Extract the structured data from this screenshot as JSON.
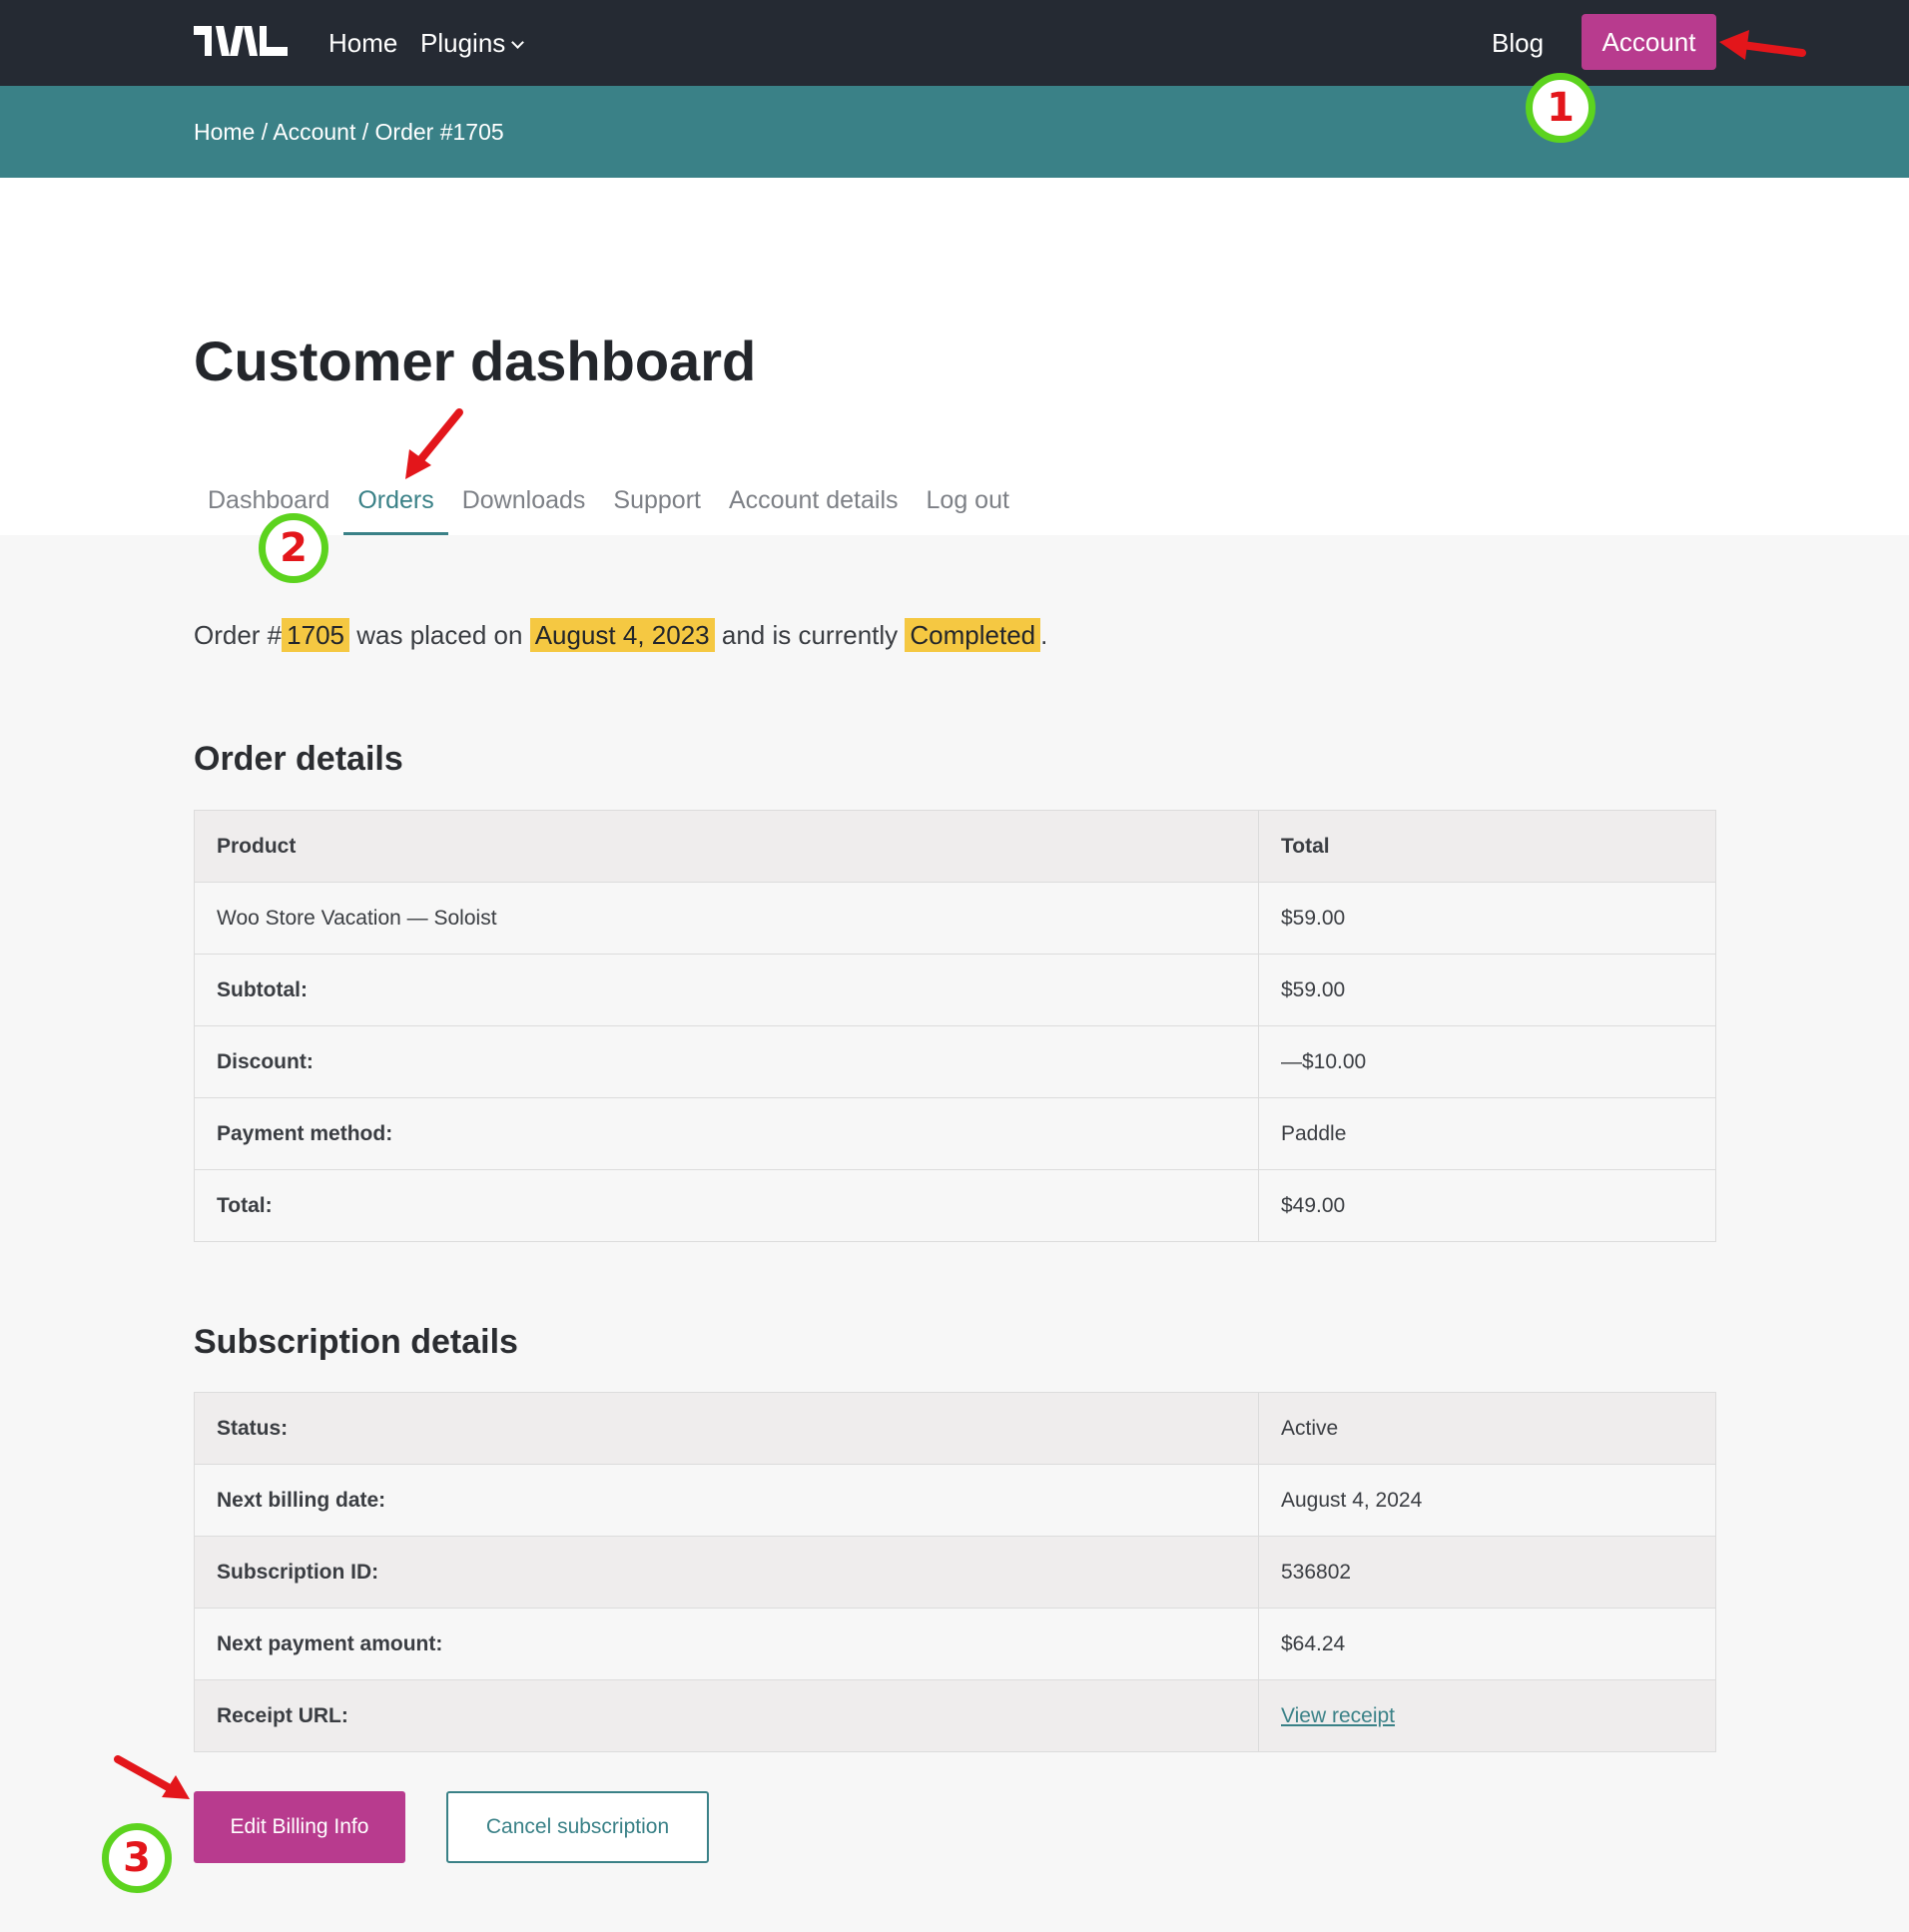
{
  "header": {
    "nav": {
      "home": "Home",
      "plugins": "Plugins",
      "blog": "Blog",
      "account": "Account"
    }
  },
  "breadcrumb": {
    "text": "Home / Account / Order #1705"
  },
  "page": {
    "title": "Customer dashboard"
  },
  "tabs": [
    {
      "label": "Dashboard",
      "active": false
    },
    {
      "label": "Orders",
      "active": true
    },
    {
      "label": "Downloads",
      "active": false
    },
    {
      "label": "Support",
      "active": false
    },
    {
      "label": "Account details",
      "active": false
    },
    {
      "label": "Log out",
      "active": false
    }
  ],
  "summary": {
    "prefix": "Order #",
    "order_number": "1705",
    "mid1": "was placed on",
    "date": "August 4, 2023",
    "mid2": "and is currently",
    "status": "Completed",
    "suffix": "."
  },
  "order_details": {
    "title": "Order details",
    "header": {
      "product": "Product",
      "total": "Total"
    },
    "item": {
      "product": "Woo Store Vacation — Soloist",
      "total": "$59.00"
    },
    "subtotal": {
      "label": "Subtotal:",
      "value": "$59.00"
    },
    "discount": {
      "label": "Discount:",
      "value": "—$10.00"
    },
    "payment_method": {
      "label": "Payment method:",
      "value": "Paddle"
    },
    "total": {
      "label": "Total:",
      "value": "$49.00"
    }
  },
  "subscription_details": {
    "title": "Subscription details",
    "status": {
      "label": "Status:",
      "value": "Active"
    },
    "next_billing_date": {
      "label": "Next billing date:",
      "value": "August 4, 2024"
    },
    "subscription_id": {
      "label": "Subscription ID:",
      "value": "536802"
    },
    "next_payment_amount": {
      "label": "Next payment amount:",
      "value": "$64.24"
    },
    "receipt_url": {
      "label": "Receipt URL:",
      "link_text": "View receipt"
    }
  },
  "actions": {
    "edit_billing": "Edit Billing Info",
    "cancel_subscription": "Cancel subscription"
  },
  "annotations": {
    "step1": "1",
    "step2": "2",
    "step3": "3"
  },
  "colors": {
    "accent": "#b83b8e",
    "teal": "#3a8187",
    "highlight": "#f5c842",
    "badge_ring": "#5cd31e",
    "badge_text": "#e3161b",
    "arrow": "#e3161b"
  }
}
